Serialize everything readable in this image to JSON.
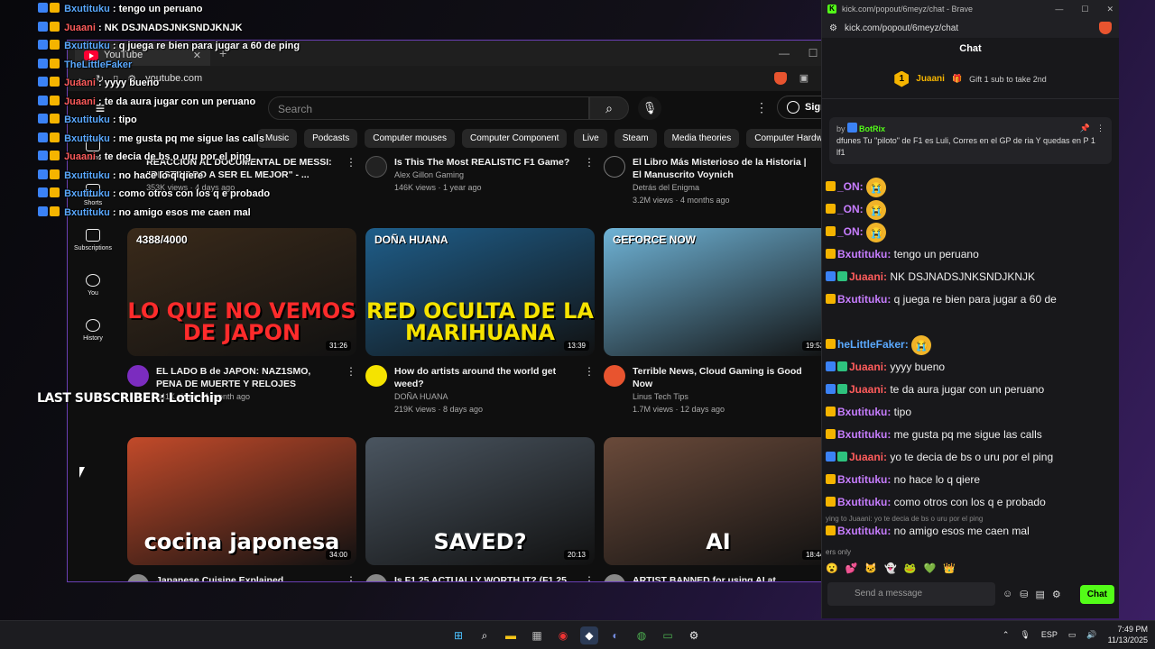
{
  "overlay": {
    "lines": [
      {
        "user": "Bxutituku",
        "msg": "tengo un peruano",
        "color": "#5aa9ff"
      },
      {
        "user": "Juaani",
        "msg": "NK DSJNADSJNKSNDJKNJK",
        "color": "#ff5c5c"
      },
      {
        "user": "Bxutituku",
        "msg": "q juega re bien para jugar a 60 de ping",
        "color": "#5aa9ff"
      },
      {
        "user": "TheLittleFaker",
        "msg": "",
        "color": "#5aa9ff"
      },
      {
        "user": "Juaani",
        "msg": "yyyy bueno",
        "color": "#ff5c5c"
      },
      {
        "user": "Juaani",
        "msg": "te da aura jugar con un peruano",
        "color": "#ff5c5c"
      },
      {
        "user": "Bxutituku",
        "msg": "tipo",
        "color": "#5aa9ff"
      },
      {
        "user": "Bxutituku",
        "msg": "me gusta pq me sigue las calls",
        "color": "#5aa9ff"
      },
      {
        "user": "Juaani",
        "msg": "te decia de bs o uru por el ping",
        "color": "#ff5c5c"
      },
      {
        "user": "Bxutituku",
        "msg": "no hace lo q qiere",
        "color": "#5aa9ff"
      },
      {
        "user": "Bxutituku",
        "msg": "como otros con los q e probado",
        "color": "#5aa9ff"
      },
      {
        "user": "Bxutituku",
        "msg": "no amigo esos me caen mal",
        "color": "#5aa9ff"
      }
    ],
    "last_subscriber": "LAST SUBSCRIBER: Lotichip"
  },
  "youtube": {
    "tab_title": "YouTube",
    "url": "youtube.com",
    "search_placeholder": "Search",
    "sign_in": "Sign in",
    "chips": [
      "Music",
      "Podcasts",
      "Computer mouses",
      "Computer Component",
      "Live",
      "Steam",
      "Media theories",
      "Computer Hardware"
    ],
    "sidebar": [
      {
        "label": "Home"
      },
      {
        "label": "Shorts"
      },
      {
        "label": "Subscriptions"
      },
      {
        "label": "You"
      },
      {
        "label": "History"
      }
    ],
    "top_row": [
      {
        "title": "REACCION AL DOCUMENTAL DE MESSI: \"DESTINADO A SER EL MEJOR\" - ...",
        "channel": "",
        "stats": "353K views · 4 days ago"
      },
      {
        "title": "Is This The Most REALISTIC F1 Game?",
        "channel": "Alex Gillon Gaming",
        "stats": "146K views · 1 year ago"
      },
      {
        "title": "El Libro Más Misterioso de la Historia | El Manuscrito Voynich",
        "channel": "Detrás del Enigma",
        "stats": "3.2M views · 4 months ago"
      }
    ],
    "videos": [
      {
        "title": "EL LADO B de JAPON: NAZ1SMO, PENA DE MUERTE Y RELOJES",
        "channel": "",
        "stats": "341K views · 1 month ago",
        "duration": "31:26",
        "thumb_text": "LO QUE NO VEMOS DE JAPON",
        "thumb_top": "4388/4000",
        "bg": "#3a2a1a",
        "accent": "#ff2b2b",
        "av": "#7b2cbf"
      },
      {
        "title": "How do artists around the world get weed?",
        "channel": "DOÑA HUANA",
        "stats": "219K views · 8 days ago",
        "duration": "13:39",
        "thumb_text": "RED OCULTA DE LA MARIHUANA",
        "thumb_top": "DOÑA HUANA",
        "bg": "#1f5e8a",
        "accent": "#f5e300",
        "av": "#f5e300"
      },
      {
        "title": "Terrible News, Cloud Gaming is Good Now",
        "channel": "Linus Tech Tips",
        "stats": "1.7M views · 12 days ago",
        "duration": "19:53",
        "thumb_text": "",
        "thumb_top": "GEFORCE NOW",
        "bg": "#6fb3d6",
        "accent": "#ffffff",
        "av": "#e8542f"
      },
      {
        "title": "Japanese Cuisine Explained",
        "channel": "",
        "stats": "",
        "duration": "34:00",
        "thumb_text": "cocina japonesa",
        "thumb_top": "",
        "bg": "#c24a2a",
        "accent": "#ffffff",
        "av": "#888888"
      },
      {
        "title": "Is F1 25 ACTUALLY WORTH IT? (F1 25",
        "channel": "",
        "stats": "",
        "duration": "20:13",
        "thumb_text": "SAVED?",
        "thumb_top": "",
        "bg": "#4a5560",
        "accent": "#ffffff",
        "av": "#888888"
      },
      {
        "title": "ARTIST BANNED for using AI at DRAGON",
        "channel": "",
        "stats": "",
        "duration": "18:44",
        "thumb_text": "AI",
        "thumb_top": "",
        "bg": "#6a4a3a",
        "accent": "#ffffff",
        "av": "#888888"
      }
    ]
  },
  "kick": {
    "window_title": "kick.com/popout/6meyz/chat - Brave",
    "url": "kick.com/popout/6meyz/chat",
    "header": "Chat",
    "gift_user": "Juaani",
    "gift_count": "1",
    "gift_text": "Gift 1 sub to take 2nd",
    "pinned_by": "by",
    "pinned_user": "BotRix",
    "pinned_text": "dfunes Tu \"piloto\" de F1 es Luli, Corres en el GP de ria Y quedas en P 1 lf1",
    "messages": [
      {
        "user": "_ON:",
        "msg": "",
        "color": "#c77dff",
        "emote": true
      },
      {
        "user": "_ON:",
        "msg": "",
        "color": "#c77dff",
        "emote": true
      },
      {
        "user": "_ON:",
        "msg": "",
        "color": "#c77dff",
        "emote": true
      },
      {
        "user": "Bxutituku:",
        "msg": " tengo un peruano",
        "color": "#c77dff"
      },
      {
        "user": "Juaani:",
        "msg": " NK DSJNADSJNKSNDJKNJK",
        "color": "#ff5c5c"
      },
      {
        "user": "Bxutituku:",
        "msg": " q juega re bien para jugar a 60 de",
        "color": "#c77dff"
      },
      {
        "user": "",
        "msg": "",
        "color": "#c77dff"
      },
      {
        "user": "heLittleFaker:",
        "msg": "",
        "color": "#5aa9ff",
        "emote": true
      },
      {
        "user": "Juaani:",
        "msg": " yyyy bueno",
        "color": "#ff5c5c"
      },
      {
        "user": "Juaani:",
        "msg": " te da aura jugar con un peruano",
        "color": "#ff5c5c"
      },
      {
        "user": "Bxutituku:",
        "msg": " tipo",
        "color": "#c77dff"
      },
      {
        "user": "Bxutituku:",
        "msg": " me gusta pq me sigue las calls",
        "color": "#c77dff"
      },
      {
        "user": "Juaani:",
        "msg": " yo te decia de bs o uru por el ping",
        "color": "#ff5c5c"
      },
      {
        "user": "Bxutituku:",
        "msg": " no hace lo q qiere",
        "color": "#c77dff"
      },
      {
        "user": "Bxutituku:",
        "msg": " como otros con los q e probado",
        "color": "#c77dff"
      }
    ],
    "reply_to": "ying to Juaani: yo te decia de bs o uru por el ping",
    "last_message": {
      "user": "Bxutituku:",
      "msg": " no amigo esos me caen mal"
    },
    "subs_only": "ers only",
    "input_placeholder": "Send a message",
    "chat_button": "Chat"
  },
  "taskbar": {
    "lang": "ESP",
    "time": "7:49 PM",
    "date": "11/13/2025"
  },
  "colors": {
    "kick_green": "#53fc18",
    "yt_red": "#ff0033"
  }
}
